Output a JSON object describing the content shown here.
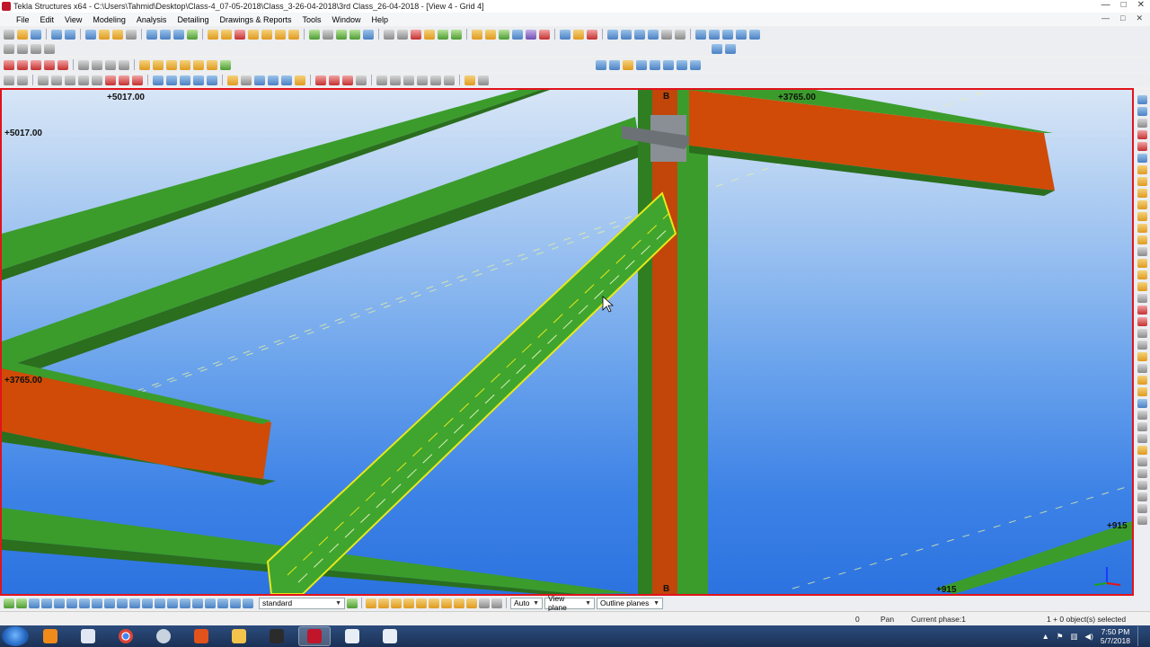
{
  "titlebar": {
    "title": "Tekla Structures x64 - C:\\Users\\Tahmid\\Desktop\\Class-4_07-05-2018\\Class_3-26-04-2018\\3rd Class_26-04-2018 - [View 4 - Grid 4]",
    "minimize": "—",
    "maximize": "□",
    "close": "✕"
  },
  "menu": {
    "items": [
      "File",
      "Edit",
      "View",
      "Modeling",
      "Analysis",
      "Detailing",
      "Drawings & Reports",
      "Tools",
      "Window",
      "Help"
    ]
  },
  "viewport": {
    "labels": {
      "elev_top_left_1": "+5017.00",
      "elev_top_left_2": "+5017.00",
      "elev_top_right": "+3765.00",
      "elev_mid_left": "+3765.00",
      "elev_bottom_right_1": "+915",
      "elev_bottom_right_2": "+915",
      "grid_top": "B",
      "grid_bottom": "B"
    },
    "colors": {
      "border": "#e1131b",
      "beam_green": "#3b9c2b",
      "beam_orange": "#cf4b07",
      "selection": "#e8e81a"
    }
  },
  "bottom": {
    "filter_value": "standard",
    "snap_mode": "Auto",
    "view_plane": "View plane",
    "outline_planes": "Outline planes"
  },
  "status": {
    "value": "0",
    "mode": "Pan",
    "phase": "Current phase:1",
    "selection": "1 + 0 object(s) selected"
  },
  "taskbar": {
    "time": "7:50 PM",
    "date": "5/7/2018"
  }
}
